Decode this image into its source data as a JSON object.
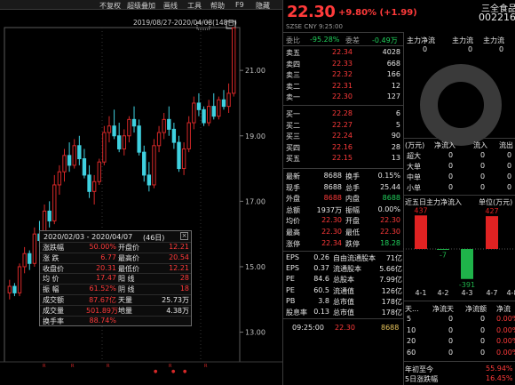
{
  "toolbar": {
    "items": [
      "不复权",
      "超级叠加",
      "画线",
      "工具",
      "帮助",
      "F9",
      "隐藏"
    ]
  },
  "chart": {
    "date_range": "2019/08/27-2020/04/08(148日)",
    "y_ticks": [
      "21.00",
      "19.00",
      "17.00",
      "15.00",
      "13.00"
    ],
    "x_ticks": [
      "20.02",
      "20.03",
      "20.04"
    ],
    "colors": {
      "up": "#d62828",
      "down": "#3fd1e0"
    }
  },
  "chart_data": {
    "type": "candlestick",
    "ylim": [
      12.2,
      22.2
    ],
    "candles": [
      [
        14.2,
        14.6,
        14.0,
        14.4
      ],
      [
        14.4,
        14.5,
        14.1,
        14.2
      ],
      [
        14.2,
        15.1,
        14.1,
        15.0
      ],
      [
        15.0,
        15.6,
        14.8,
        15.4
      ],
      [
        15.4,
        15.5,
        14.9,
        15.1
      ],
      [
        15.1,
        16.2,
        15.0,
        16.0
      ],
      [
        16.0,
        16.4,
        15.6,
        15.8
      ],
      [
        15.8,
        16.9,
        15.7,
        16.7
      ],
      [
        16.7,
        17.0,
        16.2,
        16.4
      ],
      [
        16.4,
        17.8,
        16.3,
        17.5
      ],
      [
        17.5,
        18.1,
        17.2,
        17.9
      ],
      [
        17.9,
        18.6,
        17.6,
        18.4
      ],
      [
        18.4,
        18.8,
        17.9,
        18.1
      ],
      [
        18.1,
        18.9,
        18.0,
        18.7
      ],
      [
        18.7,
        19.0,
        18.1,
        18.3
      ],
      [
        18.3,
        18.6,
        17.7,
        17.8
      ],
      [
        17.8,
        18.1,
        17.1,
        17.3
      ],
      [
        17.3,
        17.8,
        16.9,
        17.6
      ],
      [
        17.6,
        18.3,
        17.5,
        18.2
      ],
      [
        18.2,
        19.3,
        18.1,
        19.1
      ],
      [
        19.1,
        19.6,
        18.8,
        19.3
      ],
      [
        19.3,
        19.8,
        18.9,
        19.0
      ],
      [
        19.0,
        19.4,
        18.5,
        18.6
      ],
      [
        18.6,
        19.2,
        18.4,
        19.0
      ],
      [
        19.0,
        19.6,
        18.8,
        19.5
      ],
      [
        19.5,
        19.9,
        19.1,
        19.3
      ],
      [
        19.3,
        19.5,
        18.4,
        18.5
      ],
      [
        18.5,
        18.7,
        17.6,
        17.8
      ],
      [
        17.8,
        18.2,
        17.3,
        17.5
      ],
      [
        17.5,
        18.9,
        17.4,
        18.7
      ],
      [
        18.7,
        19.3,
        18.5,
        19.1
      ],
      [
        19.1,
        19.7,
        18.9,
        19.5
      ],
      [
        19.5,
        19.9,
        19.0,
        19.2
      ],
      [
        19.2,
        19.4,
        18.6,
        18.8
      ],
      [
        18.8,
        19.0,
        17.9,
        18.0
      ],
      [
        18.0,
        18.8,
        17.8,
        18.6
      ],
      [
        18.6,
        19.6,
        18.5,
        19.4
      ],
      [
        19.4,
        20.2,
        19.2,
        20.0
      ],
      [
        20.0,
        20.3,
        19.6,
        19.8
      ],
      [
        19.8,
        19.9,
        19.3,
        19.4
      ],
      [
        19.4,
        20.1,
        19.3,
        19.9
      ],
      [
        19.9,
        20.3,
        19.5,
        19.6
      ],
      [
        19.6,
        20.2,
        19.5,
        20.1
      ],
      [
        20.1,
        20.4,
        19.8,
        19.9
      ],
      [
        19.9,
        20.6,
        19.7,
        20.3
      ],
      [
        20.3,
        22.3,
        20.2,
        22.3
      ]
    ]
  },
  "infobox": {
    "range": "2020/02/03 - 2020/04/07",
    "days": "(46日)",
    "rows": [
      {
        "l1": "涨跌幅",
        "v1": "50.00%",
        "l2": "开盘价",
        "v2": "12.21"
      },
      {
        "l1": "涨  跌",
        "v1": "6.77",
        "l2": "最高价",
        "v2": "20.54"
      },
      {
        "l1": "收盘价",
        "v1": "20.31",
        "l2": "最低价",
        "v2": "12.21"
      },
      {
        "l1": "均  价",
        "v1": "17.47",
        "l2": "阳  线",
        "v2": "28"
      },
      {
        "l1": "振  幅",
        "v1": "61.52%",
        "l2": "阴  线",
        "v2": "18"
      },
      {
        "l1": "成交额",
        "v1": "87.67亿",
        "l2": "天量",
        "v2": "25.73万"
      },
      {
        "l1": "成交量",
        "v1": "501.89万",
        "l2": "地量",
        "v2": "4.38万"
      },
      {
        "l1": "换手率",
        "v1": "88.74%",
        "l2": "",
        "v2": ""
      }
    ]
  },
  "quote": {
    "price": "22.30",
    "change": "+9.80% (+1.99)",
    "name": "三全食品",
    "code": "002216",
    "market": "SZSE CNY 9:25:00",
    "weibi_label": "委比",
    "weibi_value": "-95.28%",
    "weicha_label": "委差",
    "weicha_value": "-0.49万"
  },
  "orderbook": [
    {
      "l": "卖五",
      "p": "22.34",
      "v": "4028"
    },
    {
      "l": "卖四",
      "p": "22.33",
      "v": "668"
    },
    {
      "l": "卖三",
      "p": "22.32",
      "v": "166"
    },
    {
      "l": "卖二",
      "p": "22.31",
      "v": "12"
    },
    {
      "l": "卖一",
      "p": "22.30",
      "v": "127"
    },
    {
      "l": "买一",
      "p": "22.28",
      "v": "6"
    },
    {
      "l": "买二",
      "p": "22.27",
      "v": "5"
    },
    {
      "l": "买三",
      "p": "22.24",
      "v": "90"
    },
    {
      "l": "买四",
      "p": "22.16",
      "v": "28"
    },
    {
      "l": "买五",
      "p": "22.15",
      "v": "13"
    }
  ],
  "stats": [
    {
      "l1": "最新",
      "v1": "8688",
      "l2": "换手",
      "v2": "0.15%"
    },
    {
      "l1": "现手",
      "v1": "8688",
      "l2": "总手",
      "v2": "25.44"
    },
    {
      "l1": "外盘",
      "v1": "8688",
      "l2": "内盘",
      "v2": "8688"
    },
    {
      "l1": "总额",
      "v1": "1937万",
      "l2": "振幅",
      "v2": "0.00%"
    },
    {
      "l1": "均价",
      "v1": "22.30",
      "l2": "开盘",
      "v2": "22.30"
    },
    {
      "l1": "最高",
      "v1": "22.30",
      "l2": "最低",
      "v2": "22.30"
    },
    {
      "l1": "涨停",
      "v1": "22.34",
      "l2": "跌停",
      "v2": "18.28"
    }
  ],
  "fundamentals": [
    {
      "l1": "EPS",
      "v1": "0.26",
      "l2": "自由流通股本",
      "v2": "71亿"
    },
    {
      "l1": "EPS",
      "v1": "0.37",
      "l2": "流通股本",
      "v2": "5.66亿"
    },
    {
      "l1": "PE",
      "v1": "84.6",
      "l2": "总股本",
      "v2": "7.99亿"
    },
    {
      "l1": "PE",
      "v1": "60.5",
      "l2": "流通值",
      "v2": "126亿"
    },
    {
      "l1": "PB",
      "v1": "3.8",
      "l2": "总市值",
      "v2": "178亿"
    },
    {
      "l1": "股息率",
      "v1": "0.13",
      "l2": "总市值",
      "v2": "178亿"
    }
  ],
  "last_trade": {
    "time": "09:25:00",
    "price": "22.30",
    "vol": "8688"
  },
  "capital": {
    "headers": [
      "主力净流",
      "主力流",
      "主力流"
    ],
    "values": [
      "0",
      "0",
      "0"
    ]
  },
  "flow_table": {
    "headers": [
      "(万元)",
      "净流入",
      "流入",
      "流出"
    ],
    "rows": [
      {
        "l": "超大",
        "a": "0",
        "b": "0",
        "c": "0"
      },
      {
        "l": "大单",
        "a": "0",
        "b": "0",
        "c": "0"
      },
      {
        "l": "中单",
        "a": "0",
        "b": "0",
        "c": "0"
      },
      {
        "l": "小单",
        "a": "0",
        "b": "0",
        "c": "0"
      }
    ]
  },
  "five_day": {
    "title": "近五日主力净流入",
    "unit": "单位(万元)",
    "bars": [
      {
        "label": "4-1",
        "value": 437
      },
      {
        "label": "4-2",
        "value": -7
      },
      {
        "label": "4-3",
        "value": -391
      },
      {
        "label": "4-7",
        "value": 427
      },
      {
        "label": "4-8",
        "value": 0
      }
    ]
  },
  "period_table": {
    "headers": [
      "天...",
      "净流天",
      "净流额",
      "净流"
    ],
    "rows": [
      {
        "d": "5",
        "a": "0",
        "b": "0",
        "c": "0.00%"
      },
      {
        "d": "10",
        "a": "0",
        "b": "0",
        "c": "0.00%"
      },
      {
        "d": "20",
        "a": "0",
        "b": "0",
        "c": "0.00%"
      },
      {
        "d": "60",
        "a": "0",
        "b": "0",
        "c": "0.00%"
      }
    ]
  },
  "footer": {
    "ytd_label": "年初至今",
    "ytd_value": "55.94%",
    "d5_label": "5日涨跌幅",
    "d5_value": "16.45%"
  }
}
